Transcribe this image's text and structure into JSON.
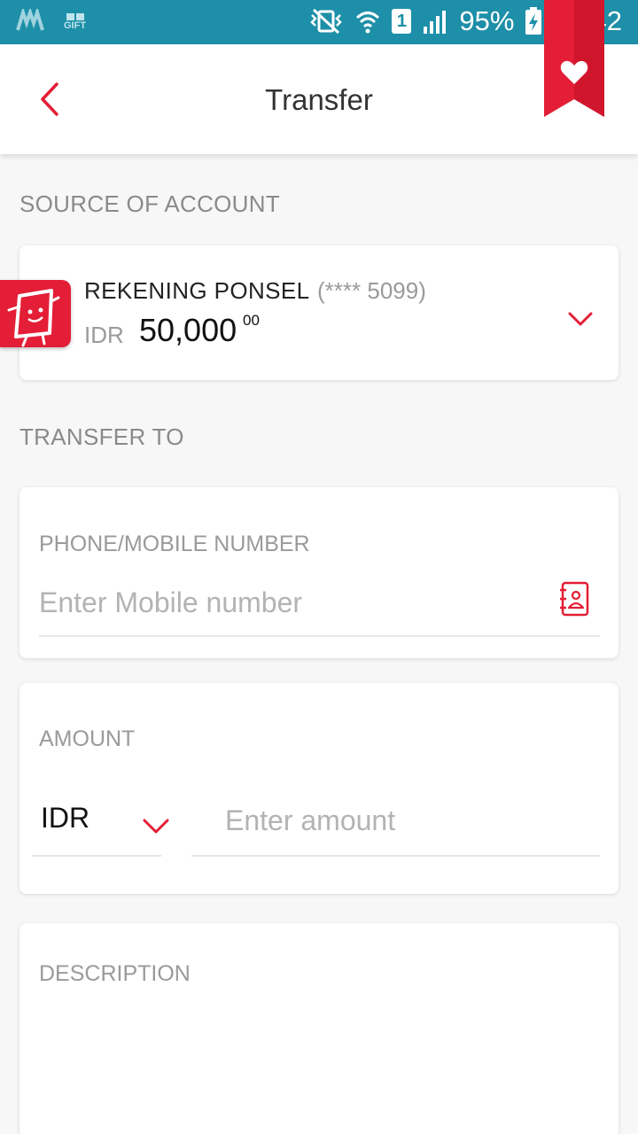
{
  "status_bar": {
    "gift_label": "GIFT",
    "sim_slot": "1",
    "battery_percent": "95%",
    "time": "17:42"
  },
  "header": {
    "title": "Transfer"
  },
  "source": {
    "label": "SOURCE OF ACCOUNT",
    "account_name": "REKENING PONSEL",
    "account_mask": "(**** 5099)",
    "currency": "IDR",
    "balance": "50,000",
    "balance_decimal": "00"
  },
  "transfer_to": {
    "label": "TRANSFER TO",
    "phone_label": "PHONE/MOBILE NUMBER",
    "phone_placeholder": "Enter Mobile number"
  },
  "amount": {
    "label": "AMOUNT",
    "currency": "IDR",
    "placeholder": "Enter amount"
  },
  "description": {
    "label": "DESCRIPTION"
  },
  "colors": {
    "accent": "#e31e36",
    "status_bar": "#1d8fa8"
  },
  "icons": [
    "app-logo-icon",
    "gift-icon",
    "vibrate-mute-icon",
    "wifi-icon",
    "signal-icon",
    "battery-charging-icon",
    "back-arrow-icon",
    "favorite-heart-icon",
    "account-logo-icon",
    "chevron-down-icon",
    "contacts-book-icon"
  ]
}
